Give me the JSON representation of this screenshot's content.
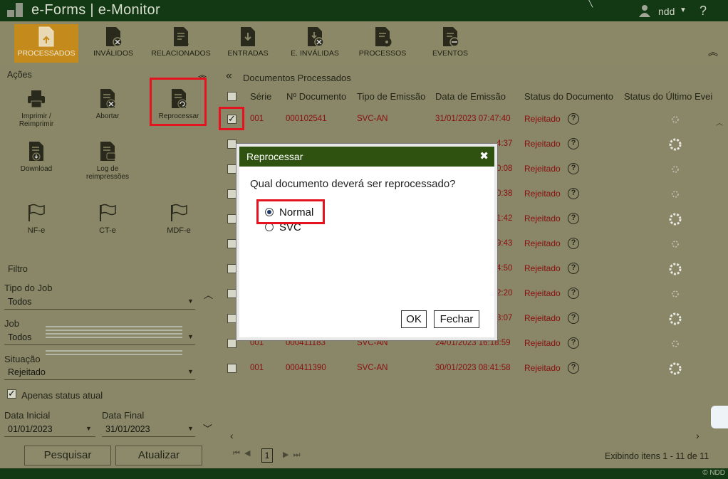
{
  "app": {
    "title": "e-Forms | e-Monitor",
    "user": "ndd",
    "help": "?",
    "copyright": "© NDD"
  },
  "toolbar": {
    "items": [
      {
        "label": "PROCESSADOS",
        "icon": "document-upload-icon",
        "active": true
      },
      {
        "label": "INVÁLIDOS",
        "icon": "document-invalid-icon",
        "active": false
      },
      {
        "label": "RELACIONADOS",
        "icon": "document-link-icon",
        "active": false
      },
      {
        "label": "ENTRADAS",
        "icon": "document-download-icon",
        "active": false
      },
      {
        "label": "E. INVÁLIDAS",
        "icon": "document-invalid-entry-icon",
        "active": false
      },
      {
        "label": "PROCESSOS",
        "icon": "document-gear-icon",
        "active": false
      },
      {
        "label": "EVENTOS",
        "icon": "document-event-icon",
        "active": false
      }
    ]
  },
  "actions": {
    "title": "Ações",
    "items": [
      {
        "label": "Imprimir / Reimprimir",
        "icon": "printer-icon"
      },
      {
        "label": "Abortar",
        "icon": "document-cancel-icon"
      },
      {
        "label": "Reprocessar",
        "icon": "document-reprocess-icon"
      },
      {
        "label": "Download",
        "icon": "document-download-icon"
      },
      {
        "label": "Log de reimpressões",
        "icon": "document-log-icon"
      }
    ],
    "flags": [
      {
        "label": "NF-e",
        "icon": "flag-icon"
      },
      {
        "label": "CT-e",
        "icon": "flag-icon"
      },
      {
        "label": "MDF-e",
        "icon": "flag-icon"
      }
    ]
  },
  "filter": {
    "title": "Filtro",
    "tipo_job": {
      "label": "Tipo do Job",
      "value": "Todos"
    },
    "job": {
      "label": "Job",
      "value": "Todos"
    },
    "situacao": {
      "label": "Situação",
      "value": "Rejeitado"
    },
    "apenas_status": {
      "label": "Apenas status atual",
      "checked": true
    },
    "data_inicial": {
      "label": "Data Inicial",
      "value": "01/01/2023"
    },
    "data_final": {
      "label": "Data Final",
      "value": "31/01/2023"
    },
    "btn_pesquisar": "Pesquisar",
    "btn_atualizar": "Atualizar"
  },
  "grid": {
    "title": "Documentos Processados",
    "columns": [
      "Série",
      "Nº Documento",
      "Tipo de Emissão",
      "Data de Emissão",
      "Status do Documento",
      "Status do Último Evei"
    ],
    "rows": [
      {
        "serie": "001",
        "numero": "000102541",
        "tipo": "SVC-AN",
        "data": "31/01/2023 07:47:40",
        "status": "Rejeitado",
        "checked": true
      },
      {
        "serie": "",
        "numero": "",
        "tipo": "",
        "data": "4:37",
        "status": "Rejeitado",
        "checked": false
      },
      {
        "serie": "",
        "numero": "",
        "tipo": "",
        "data": "0:08",
        "status": "Rejeitado",
        "checked": false
      },
      {
        "serie": "",
        "numero": "",
        "tipo": "",
        "data": "0:38",
        "status": "Rejeitado",
        "checked": false
      },
      {
        "serie": "",
        "numero": "",
        "tipo": "",
        "data": "1:42",
        "status": "Rejeitado",
        "checked": false
      },
      {
        "serie": "",
        "numero": "",
        "tipo": "",
        "data": "9:43",
        "status": "Rejeitado",
        "checked": false
      },
      {
        "serie": "",
        "numero": "",
        "tipo": "",
        "data": "4:50",
        "status": "Rejeitado",
        "checked": false
      },
      {
        "serie": "",
        "numero": "",
        "tipo": "",
        "data": "2:20",
        "status": "Rejeitado",
        "checked": false
      },
      {
        "serie": "",
        "numero": "",
        "tipo": "",
        "data": "3:07",
        "status": "Rejeitado",
        "checked": false
      },
      {
        "serie": "001",
        "numero": "000411183",
        "tipo": "SVC-AN",
        "data": "24/01/2023 16:18:59",
        "status": "Rejeitado",
        "checked": false
      },
      {
        "serie": "001",
        "numero": "000411390",
        "tipo": "SVC-AN",
        "data": "30/01/2023 08:41:58",
        "status": "Rejeitado",
        "checked": false
      }
    ],
    "pager": {
      "page": "1",
      "info": "Exibindo itens 1 - 11 de 11"
    }
  },
  "dialog": {
    "title": "Reprocessar",
    "question": "Qual documento deverá ser reprocessado?",
    "options": [
      {
        "label": "Normal",
        "selected": true
      },
      {
        "label": "SVC",
        "selected": false
      }
    ],
    "ok": "OK",
    "close": "Fechar"
  },
  "colors": {
    "titlebar": "#123814",
    "background": "#898767",
    "active_tab": "#c48a1c",
    "rejected_text": "#8a0e10",
    "dialog_header": "#2f5210",
    "highlight": "#e3141f"
  }
}
